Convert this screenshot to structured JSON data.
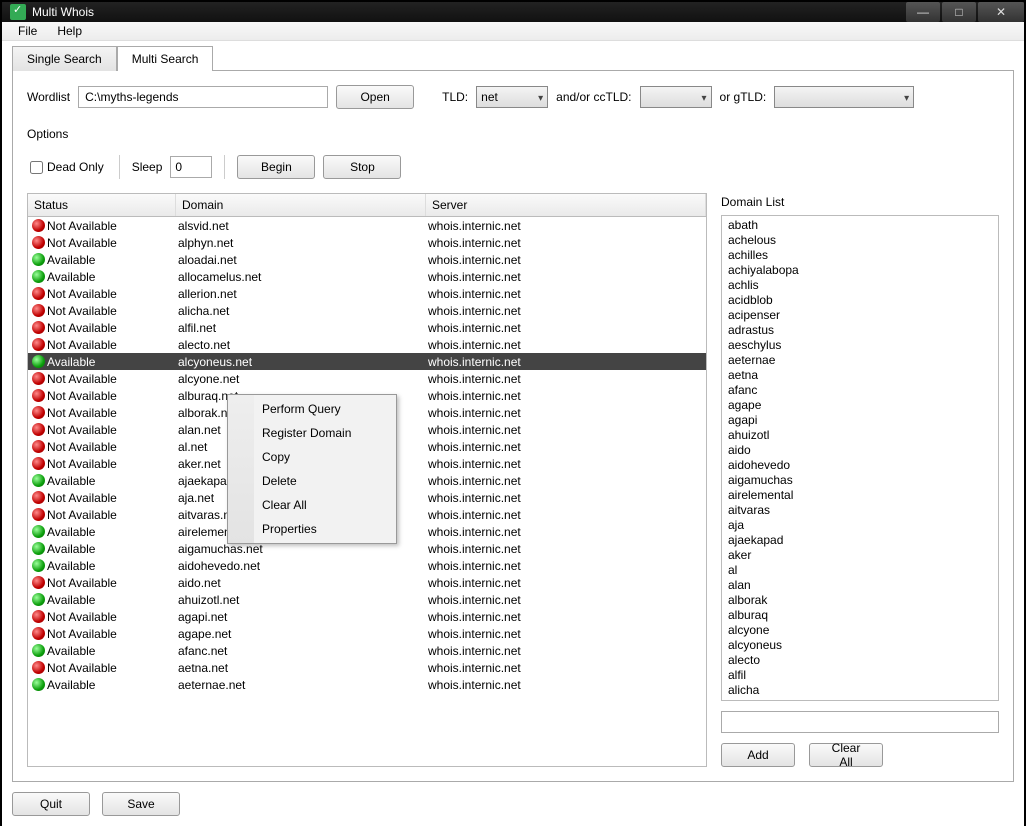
{
  "window": {
    "title": "Multi Whois"
  },
  "menubar": {
    "file": "File",
    "help": "Help"
  },
  "tabs": {
    "single": "Single Search",
    "multi": "Multi Search"
  },
  "search": {
    "wordlist_label": "Wordlist",
    "wordlist_value": "C:\\myths-legends",
    "open": "Open",
    "tld_label": "TLD:",
    "tld_value": "net",
    "cctld_label": "and/or ccTLD:",
    "gtld_label": "or gTLD:"
  },
  "options": {
    "label": "Options",
    "dead_only": "Dead Only",
    "sleep_label": "Sleep",
    "sleep_value": "0",
    "begin": "Begin",
    "stop": "Stop"
  },
  "columns": {
    "status": "Status",
    "domain": "Domain",
    "server": "Server"
  },
  "rows": [
    {
      "status": "Not Available",
      "avail": false,
      "domain": "alsvid.net",
      "server": "whois.internic.net"
    },
    {
      "status": "Not Available",
      "avail": false,
      "domain": "alphyn.net",
      "server": "whois.internic.net"
    },
    {
      "status": "Available",
      "avail": true,
      "domain": "aloadai.net",
      "server": "whois.internic.net"
    },
    {
      "status": "Available",
      "avail": true,
      "domain": "allocamelus.net",
      "server": "whois.internic.net"
    },
    {
      "status": "Not Available",
      "avail": false,
      "domain": "allerion.net",
      "server": "whois.internic.net"
    },
    {
      "status": "Not Available",
      "avail": false,
      "domain": "alicha.net",
      "server": "whois.internic.net"
    },
    {
      "status": "Not Available",
      "avail": false,
      "domain": "alfil.net",
      "server": "whois.internic.net"
    },
    {
      "status": "Not Available",
      "avail": false,
      "domain": "alecto.net",
      "server": "whois.internic.net"
    },
    {
      "status": "Available",
      "avail": true,
      "domain": "alcyoneus.net",
      "server": "whois.internic.net",
      "selected": true
    },
    {
      "status": "Not Available",
      "avail": false,
      "domain": "alcyone.net",
      "server": "whois.internic.net"
    },
    {
      "status": "Not Available",
      "avail": false,
      "domain": "alburaq.net",
      "server": "whois.internic.net"
    },
    {
      "status": "Not Available",
      "avail": false,
      "domain": "alborak.net",
      "server": "whois.internic.net"
    },
    {
      "status": "Not Available",
      "avail": false,
      "domain": "alan.net",
      "server": "whois.internic.net"
    },
    {
      "status": "Not Available",
      "avail": false,
      "domain": "al.net",
      "server": "whois.internic.net"
    },
    {
      "status": "Not Available",
      "avail": false,
      "domain": "aker.net",
      "server": "whois.internic.net"
    },
    {
      "status": "Available",
      "avail": true,
      "domain": "ajaekapad.net",
      "server": "whois.internic.net"
    },
    {
      "status": "Not Available",
      "avail": false,
      "domain": "aja.net",
      "server": "whois.internic.net"
    },
    {
      "status": "Not Available",
      "avail": false,
      "domain": "aitvaras.net",
      "server": "whois.internic.net"
    },
    {
      "status": "Available",
      "avail": true,
      "domain": "airelemental.net",
      "server": "whois.internic.net"
    },
    {
      "status": "Available",
      "avail": true,
      "domain": "aigamuchas.net",
      "server": "whois.internic.net"
    },
    {
      "status": "Available",
      "avail": true,
      "domain": "aidohevedo.net",
      "server": "whois.internic.net"
    },
    {
      "status": "Not Available",
      "avail": false,
      "domain": "aido.net",
      "server": "whois.internic.net"
    },
    {
      "status": "Available",
      "avail": true,
      "domain": "ahuizotl.net",
      "server": "whois.internic.net"
    },
    {
      "status": "Not Available",
      "avail": false,
      "domain": "agapi.net",
      "server": "whois.internic.net"
    },
    {
      "status": "Not Available",
      "avail": false,
      "domain": "agape.net",
      "server": "whois.internic.net"
    },
    {
      "status": "Available",
      "avail": true,
      "domain": "afanc.net",
      "server": "whois.internic.net"
    },
    {
      "status": "Not Available",
      "avail": false,
      "domain": "aetna.net",
      "server": "whois.internic.net"
    },
    {
      "status": "Available",
      "avail": true,
      "domain": "aeternae.net",
      "server": "whois.internic.net"
    }
  ],
  "domain_list": {
    "label": "Domain List",
    "items": [
      "abath",
      "achelous",
      "achilles",
      "achiyalabopa",
      "achlis",
      "acidblob",
      "acipenser",
      "adrastus",
      "aeschylus",
      "aeternae",
      "aetna",
      "afanc",
      "agape",
      "agapi",
      "ahuizotl",
      "aido",
      "aidohevedo",
      "aigamuchas",
      "airelemental",
      "aitvaras",
      "aja",
      "ajaekapad",
      "aker",
      "al",
      "alan",
      "alborak",
      "alburaq",
      "alcyone",
      "alcyoneus",
      "alecto",
      "alfil",
      "alicha"
    ],
    "add": "Add",
    "clear_all": "Clear All"
  },
  "context_menu": [
    "Perform Query",
    "Register Domain",
    "Copy",
    "Delete",
    "Clear All",
    "Properties"
  ],
  "footer": {
    "quit": "Quit",
    "save": "Save"
  }
}
